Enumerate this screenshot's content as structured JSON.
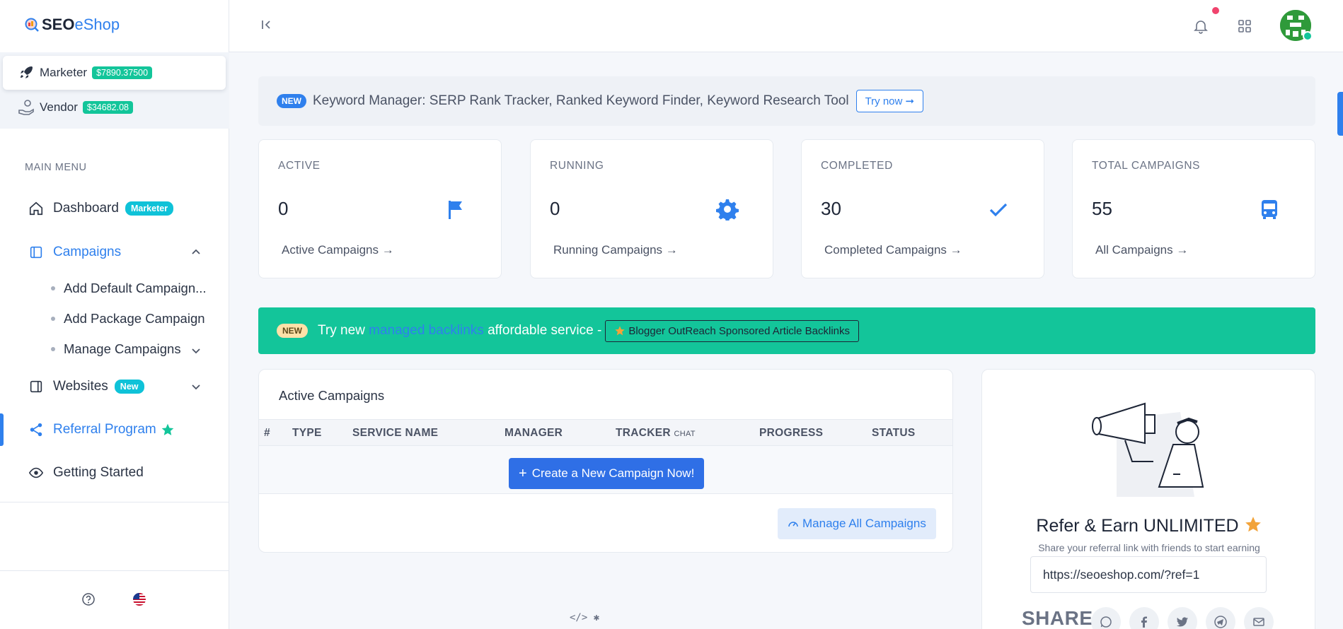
{
  "brand": {
    "seo": "SEO",
    "eshop": "eShop"
  },
  "accounts": [
    {
      "label": "Marketer",
      "balance": "$7890.37500"
    },
    {
      "label": "Vendor",
      "balance": "$34682.08"
    }
  ],
  "sidebar": {
    "menu_heading": "MAIN MENU",
    "dashboard": {
      "label": "Dashboard",
      "badge": "Marketer"
    },
    "campaigns": {
      "label": "Campaigns"
    },
    "sub_items": [
      "Add Default Campaign...",
      "Add Package Campaign",
      "Manage Campaigns"
    ],
    "websites": {
      "label": "Websites",
      "badge": "New"
    },
    "referral": {
      "label": "Referral Program"
    },
    "getting_started": {
      "label": "Getting Started"
    }
  },
  "announcement": {
    "badge": "NEW",
    "text": "Keyword Manager: SERP Rank Tracker, Ranked Keyword Finder, Keyword Research Tool",
    "button": "Try now ➞"
  },
  "stats": [
    {
      "label": "ACTIVE",
      "value": "0",
      "link": "Active Campaigns →",
      "icon": "flag-icon"
    },
    {
      "label": "RUNNING",
      "value": "0",
      "link": "Running Campaigns →",
      "icon": "gear-icon"
    },
    {
      "label": "COMPLETED",
      "value": "30",
      "link": "Completed Campaigns →",
      "icon": "check-icon"
    },
    {
      "label": "TOTAL CAMPAIGNS",
      "value": "55",
      "link": "All Campaigns →",
      "icon": "bus-icon"
    }
  ],
  "promo": {
    "badge": "NEW",
    "prefix": "Try new",
    "link": "managed backlinks",
    "suffix": "affordable service -",
    "box": "Blogger OutReach Sponsored Article Backlinks"
  },
  "active_campaigns": {
    "title": "Active Campaigns",
    "columns": [
      "#",
      "TYPE",
      "SERVICE NAME",
      "MANAGER",
      "TRACKER",
      "PROGRESS",
      "STATUS"
    ],
    "tracker_sub": "CHAT",
    "create_button": "Create a New Campaign Now!",
    "manage_button": "Manage All Campaigns"
  },
  "referral": {
    "title": "Refer & Earn UNLIMITED",
    "subtitle": "Share your referral link with friends to start earning",
    "link": "https://seoeshop.com/?ref=1",
    "share_label": "SHARE:"
  },
  "colors": {
    "accent": "#2f80ed",
    "success": "#13c59a",
    "badge": "#0fc2d8"
  }
}
